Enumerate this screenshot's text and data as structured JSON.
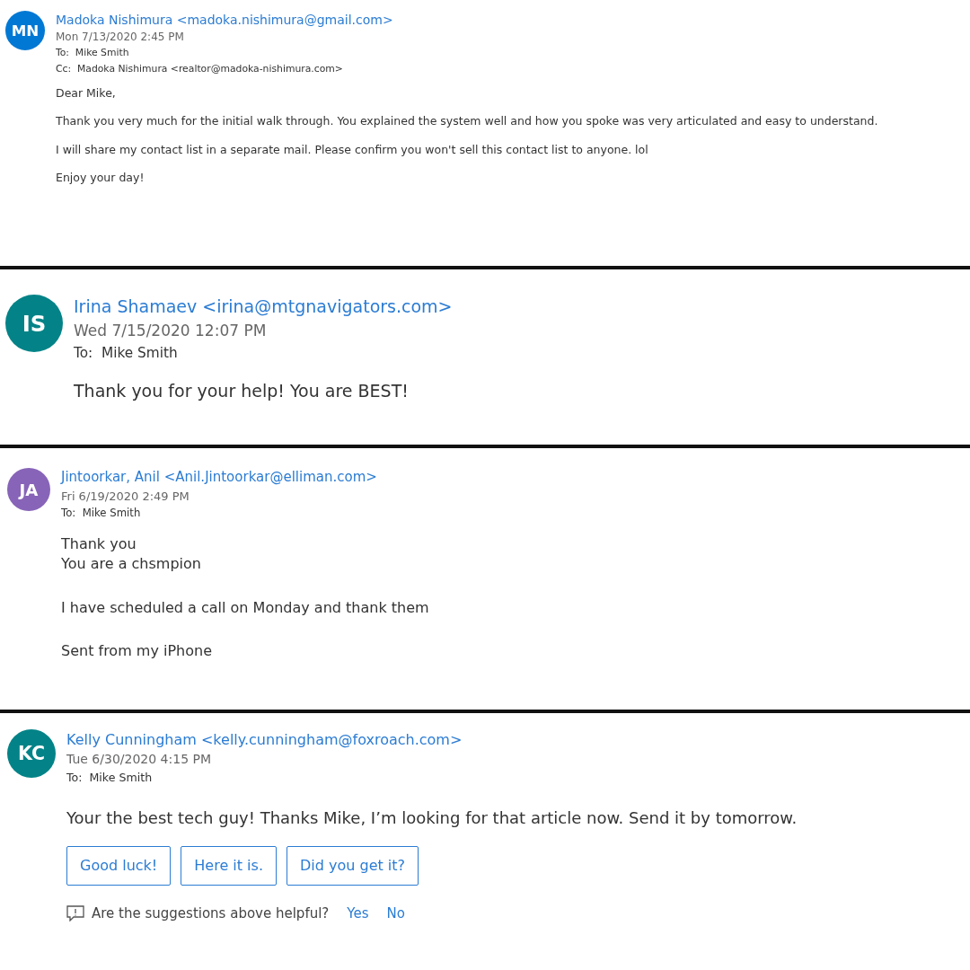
{
  "emails": [
    {
      "initials": "MN",
      "color": "#0078d4",
      "sender": "Madoka Nishimura <madoka.nishimura@gmail.com>",
      "date": "Mon 7/13/2020 2:45 PM",
      "recipients": [
        {
          "label": "To:",
          "value": "Mike Smith"
        },
        {
          "label": "Cc:",
          "value": "Madoka Nishimura <realtor@madoka-nishimura.com>"
        }
      ],
      "body": [
        "Dear Mike,",
        "Thank you very much for the initial walk through.  You explained the system well and how you spoke was very articulated and easy to understand.",
        "I will share my contact list in a separate mail.  Please confirm you won't sell this contact list to anyone. lol",
        "Enjoy your day!"
      ]
    },
    {
      "initials": "IS",
      "color": "#038387",
      "sender": "Irina Shamaev <irina@mtgnavigators.com>",
      "date": "Wed 7/15/2020 12:07 PM",
      "recipients": [
        {
          "label": "To:",
          "value": "Mike Smith"
        }
      ],
      "body": [
        "Thank you for your help! You are BEST!"
      ]
    },
    {
      "initials": "JA",
      "color": "#8764b8",
      "sender": "Jintoorkar, Anil <Anil.Jintoorkar@elliman.com>",
      "date": "Fri 6/19/2020 2:49 PM",
      "recipients": [
        {
          "label": "To:",
          "value": "Mike Smith"
        }
      ],
      "body": [
        "Thank you\nYou are a chsmpion",
        "I have scheduled a call on Monday and thank them",
        "Sent from my iPhone"
      ]
    },
    {
      "initials": "KC",
      "color": "#038387",
      "sender": "Kelly Cunningham <kelly.cunningham@foxroach.com>",
      "date": "Tue 6/30/2020 4:15 PM",
      "recipients": [
        {
          "label": "To:",
          "value": "Mike Smith"
        }
      ],
      "body": [
        "Your the best tech guy! Thanks Mike, I’m looking for that article now. Send it by tomorrow."
      ],
      "suggestions": [
        "Good luck!",
        "Here it is.",
        "Did you get it?"
      ],
      "feedback": {
        "question": "Are the suggestions above helpful?",
        "yes": "Yes",
        "no": "No"
      }
    }
  ]
}
